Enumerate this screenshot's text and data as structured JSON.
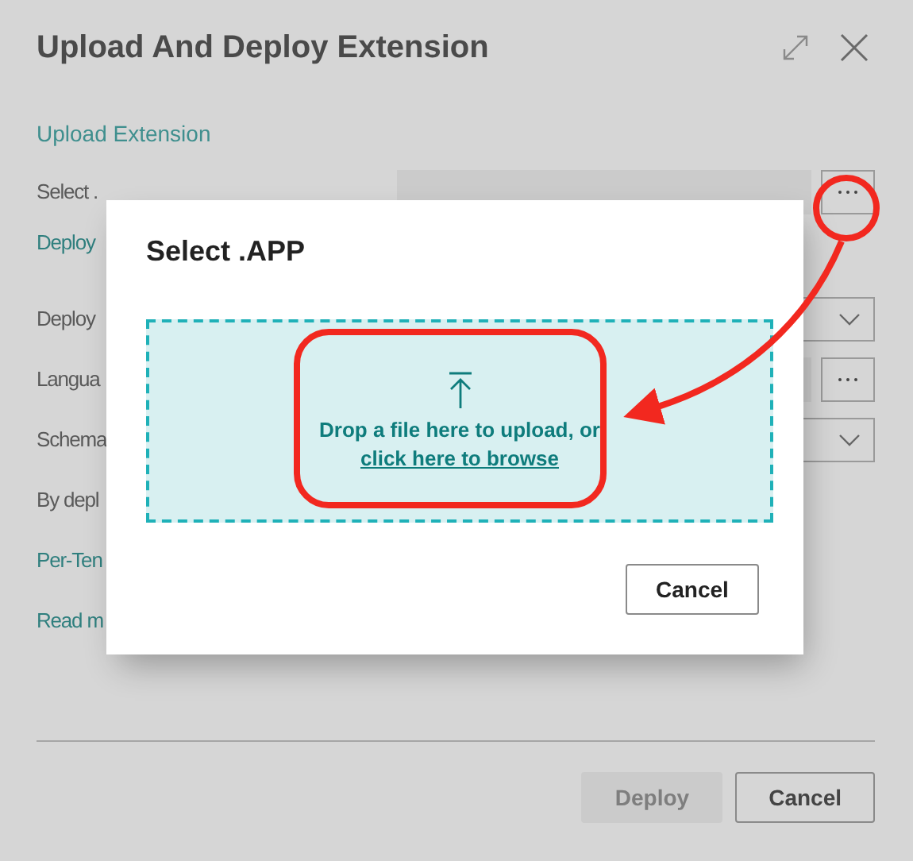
{
  "dialog": {
    "title": "Upload And Deploy Extension",
    "section_link": "Upload Extension",
    "rows": [
      {
        "kind": "file",
        "label": "Select ."
      },
      {
        "kind": "link",
        "label": "Deploy"
      },
      {
        "kind": "dropdown",
        "label": "Deploy"
      },
      {
        "kind": "lookup",
        "label": "Langua"
      },
      {
        "kind": "dropdown",
        "label": "Schema"
      },
      {
        "kind": "text",
        "label": "By depl"
      },
      {
        "kind": "link",
        "label": "Per-Ten"
      },
      {
        "kind": "link",
        "label": "Read m"
      }
    ],
    "buttons": [
      {
        "label": "Deploy",
        "disabled": true
      },
      {
        "label": "Cancel",
        "disabled": false
      }
    ]
  },
  "modal": {
    "title": "Select .APP",
    "drop_text": "Drop a file here to upload, or",
    "browse_link": "click here to browse",
    "cancel": "Cancel"
  }
}
